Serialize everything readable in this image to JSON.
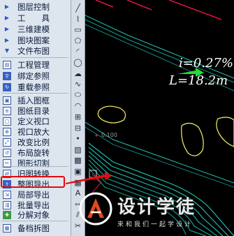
{
  "menu": {
    "items": [
      {
        "label": "图层控制",
        "icon": "layer-control-icon",
        "style": "arrow",
        "glyph": "▶"
      },
      {
        "label": "工　　具",
        "icon": "tools-icon",
        "style": "arrow",
        "glyph": "▶"
      },
      {
        "label": "三维建模",
        "icon": "3d-modeling-icon",
        "style": "arrow",
        "glyph": "▶"
      },
      {
        "label": "图块图案",
        "icon": "block-pattern-icon",
        "style": "arrow",
        "glyph": "▶"
      },
      {
        "label": "文件布图",
        "icon": "file-layout-icon",
        "style": "arrow",
        "glyph": "▼"
      },
      {
        "label": "工程管理",
        "icon": "project-manager-icon",
        "style": "box",
        "glyph": "▤"
      },
      {
        "label": "绑定参照",
        "icon": "bind-xref-icon",
        "style": "blue",
        "glyph": "⚲"
      },
      {
        "label": "重载参照",
        "icon": "reload-xref-icon",
        "style": "blue",
        "glyph": "↻"
      },
      {
        "label": "插入图框",
        "icon": "insert-frame-icon",
        "style": "box",
        "glyph": "▣"
      },
      {
        "label": "图纸目录",
        "icon": "drawing-catalog-icon",
        "style": "box",
        "glyph": "≡"
      },
      {
        "label": "定义视口",
        "icon": "define-viewport-icon",
        "style": "box",
        "glyph": "▢"
      },
      {
        "label": "视口放大",
        "icon": "viewport-zoom-icon",
        "style": "box",
        "glyph": "⊕"
      },
      {
        "label": "改变比例",
        "icon": "change-scale-icon",
        "style": "box",
        "glyph": "⤢"
      },
      {
        "label": "布局旋转",
        "icon": "layout-rotate-icon",
        "style": "box",
        "glyph": "↺"
      },
      {
        "label": "图形切割",
        "icon": "shape-cut-icon",
        "style": "box",
        "glyph": "✂"
      },
      {
        "label": "旧图转换",
        "icon": "old-drawing-convert-icon",
        "style": "box",
        "glyph": "⇄"
      },
      {
        "label": "整图导出",
        "icon": "export-whole-drawing-icon",
        "style": "blue",
        "glyph": "⇪"
      },
      {
        "label": "局部导出",
        "icon": "partial-export-icon",
        "style": "box",
        "glyph": "⇲"
      },
      {
        "label": "批量导出",
        "icon": "batch-export-icon",
        "style": "box",
        "glyph": "⇶"
      },
      {
        "label": "分解对象",
        "icon": "explode-object-icon",
        "style": "green",
        "glyph": "✚"
      },
      {
        "label": "备档拆图",
        "icon": "archive-split-icon",
        "style": "box",
        "glyph": "▦"
      }
    ]
  },
  "toolbar": {
    "tools": [
      "line-tool-icon",
      "polyline-tool-icon",
      "rectangle-tool-icon",
      "polygon-tool-icon",
      "arc-tool-icon",
      "circle-tool-icon",
      "revision-cloud-icon",
      "spline-tool-icon",
      "ellipse-tool-icon",
      "ellipse-arc-icon",
      "insert-block-icon",
      "make-block-icon",
      "point-tool-icon",
      "hatch-tool-icon",
      "gradient-tool-icon",
      "region-tool-icon",
      "table-tool-icon",
      "mtext-tool-icon",
      "measure-tool-icon",
      "offset-tool-icon",
      "trim-tool-icon"
    ],
    "glyphs": [
      "╱",
      "⌇",
      "▭",
      "⬠",
      "◜",
      "◯",
      "☁",
      "∿",
      "⬭",
      "◠",
      "⊞",
      "⊟",
      "•",
      "▨",
      "▩",
      "▣",
      "▦",
      "A",
      "⇿",
      "⫽",
      "✂"
    ]
  },
  "canvas": {
    "slope_label": "i=0.27%",
    "length_label": "L=18.2m",
    "station_label": "0.100"
  },
  "watermark": {
    "title": "设计学徒",
    "subtitle": "来和我们一起学设计"
  },
  "colors": {
    "highlight": "#e60a0a",
    "slope_arrow": "#22dd33",
    "curb": "#e8e060",
    "road_edge": "#20c0b0",
    "boundary": "#e01040"
  }
}
